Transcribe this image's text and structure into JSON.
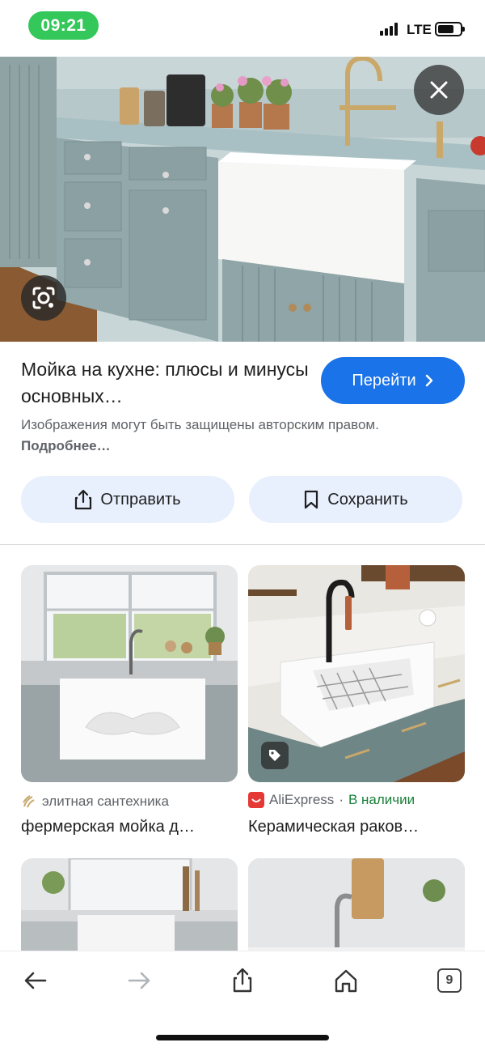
{
  "status_bar": {
    "time": "09:21",
    "network": "LTE"
  },
  "viewer": {
    "title": "Мойка на кухне: плюсы и минусы основных…",
    "go_button": "Перейти",
    "copyright_text": "Изображения могут быть защищены авторским правом.",
    "more_link": "Подробнее…",
    "share_label": "Отправить",
    "save_label": "Сохранить"
  },
  "results": [
    {
      "source": "элитная сантехника",
      "availability": "",
      "title": "фермерская мойка д…"
    },
    {
      "source": "AliExpress",
      "availability": "В наличии",
      "title": "Керамическая раков…"
    }
  ],
  "toolbar": {
    "tab_count": "9"
  },
  "colors": {
    "accent": "#1a73e8",
    "button_bg": "#e8f0fe",
    "available": "#188038",
    "time_pill": "#34c759"
  },
  "icons": [
    "close-icon",
    "lens-icon",
    "share-icon",
    "bookmark-icon",
    "tag-icon",
    "back-icon",
    "forward-icon",
    "home-icon"
  ]
}
